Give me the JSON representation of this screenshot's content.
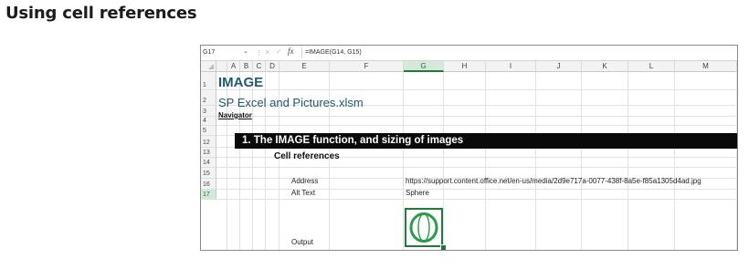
{
  "page": {
    "title": "Using cell references"
  },
  "formula_bar": {
    "name_box": "G17",
    "formula": "=IMAGE(G14, G15)"
  },
  "columns": [
    "A",
    "B",
    "C",
    "D",
    "E",
    "F",
    "G",
    "H",
    "I",
    "J",
    "K",
    "L",
    "M"
  ],
  "selected_column": "G",
  "rows": [
    "1",
    "2",
    "3",
    "4",
    "5",
    "12",
    "13",
    "14",
    "15",
    "16",
    "17"
  ],
  "selected_row": "17",
  "cells": {
    "a1": "IMAGE",
    "a2": "SP Excel and Pictures.xlsm",
    "a3": "Navigator",
    "b5": "1.  The IMAGE function, and sizing of images",
    "c12": "Cell references",
    "e14": "Address",
    "g14": "https://support.content.office.net/en-us/media/2d9e717a-0077-438f-8a5e-f85a1305d4ad.jpg",
    "e15": "Alt Text",
    "g15": "Sphere",
    "e17": "Output"
  },
  "colors": {
    "title_teal": "#1f5a6e",
    "selection_green": "#1e7b3c",
    "banner_black": "#0a0a0a",
    "sphere_green": "#2a9b4a"
  },
  "icons": [
    "dropdown-caret-icon",
    "cancel-x-icon",
    "enter-check-icon",
    "function-fx-icon",
    "sphere-image"
  ]
}
